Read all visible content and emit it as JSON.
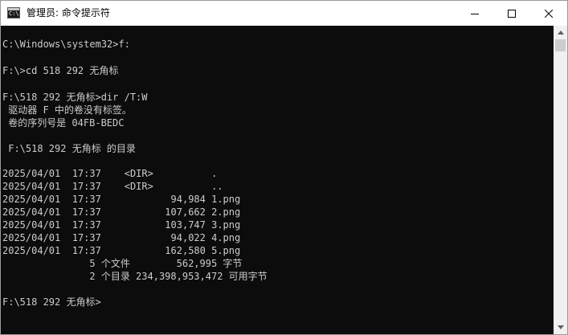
{
  "window": {
    "title": "管理员: 命令提示符",
    "icon_text": "C:\\",
    "icon": "console-icon",
    "buttons": {
      "minimize": "minimize-icon",
      "maximize": "maximize-icon",
      "close": "close-icon"
    }
  },
  "console": {
    "lines": [
      "C:\\Windows\\system32>f:",
      "",
      "F:\\>cd 518 292 无角标",
      "",
      "F:\\518 292 无角标>dir /T:W",
      " 驱动器 F 中的卷没有标签。",
      " 卷的序列号是 04FB-BEDC",
      "",
      " F:\\518 292 无角标 的目录",
      "",
      "2025/04/01  17:37    <DIR>          .",
      "2025/04/01  17:37    <DIR>          ..",
      "2025/04/01  17:37            94,984 1.png",
      "2025/04/01  17:37           107,662 2.png",
      "2025/04/01  17:37           103,747 3.png",
      "2025/04/01  17:37            94,022 4.png",
      "2025/04/01  17:37           162,580 5.png",
      "               5 个文件        562,995 字节",
      "               2 个目录 234,398,953,472 可用字节",
      "",
      "F:\\518 292 无角标>"
    ]
  },
  "colors": {
    "console_bg": "#0c0c0c",
    "console_text": "#cccccc",
    "titlebar_bg": "#ffffff",
    "scrollbar_bg": "#f0f0f0"
  }
}
